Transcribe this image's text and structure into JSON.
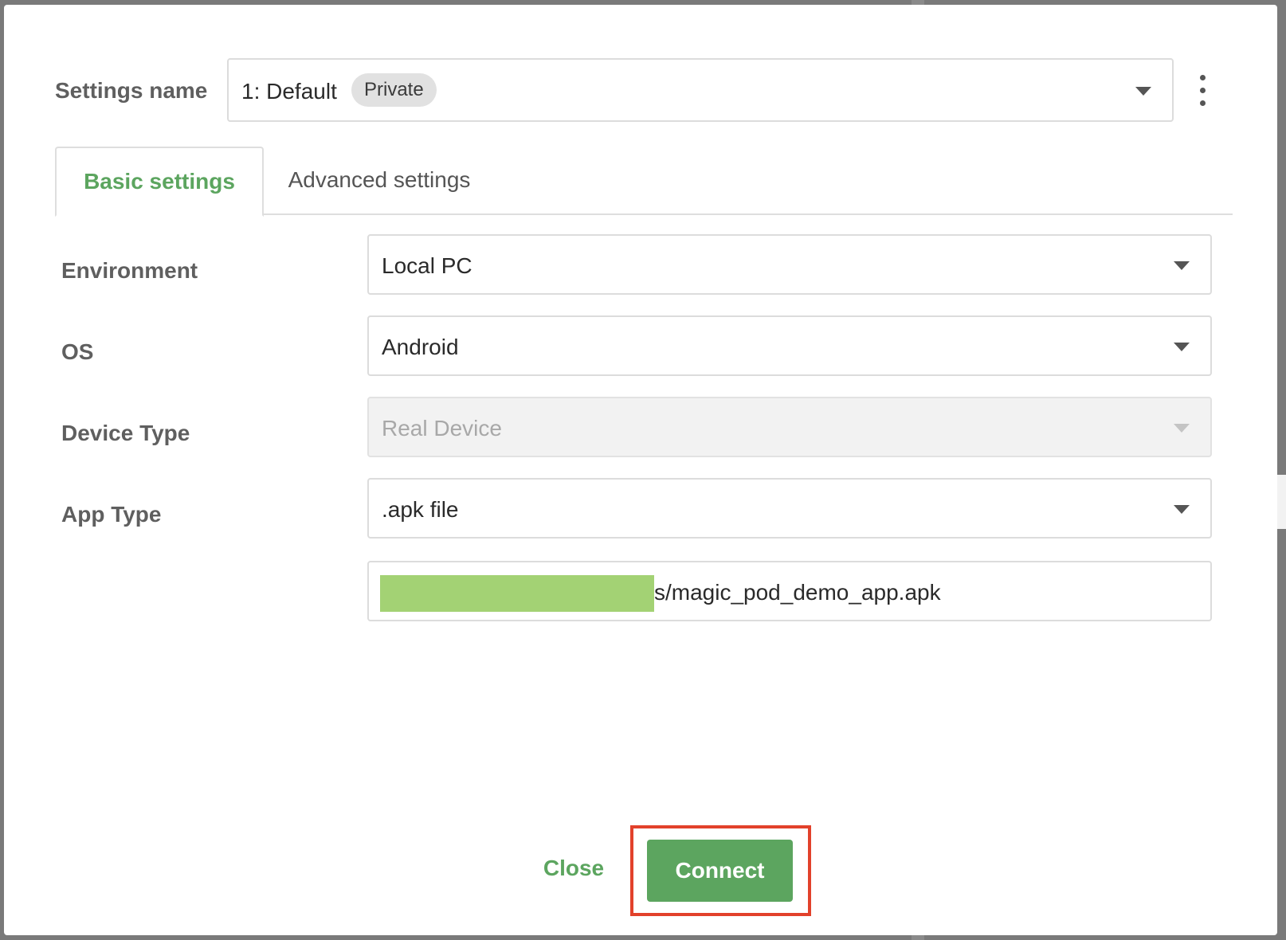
{
  "header": {
    "settings_label": "Settings name",
    "settings_value": "1: Default",
    "settings_badge": "Private"
  },
  "tabs": [
    {
      "label": "Basic settings",
      "active": true
    },
    {
      "label": "Advanced settings",
      "active": false
    }
  ],
  "form": {
    "environment": {
      "label": "Environment",
      "value": "Local PC"
    },
    "os": {
      "label": "OS",
      "value": "Android"
    },
    "device_type": {
      "label": "Device Type",
      "value": "Real Device",
      "disabled": true
    },
    "app_type": {
      "label": "App Type",
      "value": ".apk file"
    },
    "app_path": {
      "value": "s/magic_pod_demo_app.apk"
    }
  },
  "footer": {
    "close_label": "Close",
    "connect_label": "Connect"
  },
  "colors": {
    "accent": "#5ca55f",
    "highlight": "#e2412b",
    "redaction": "#a3d274"
  }
}
